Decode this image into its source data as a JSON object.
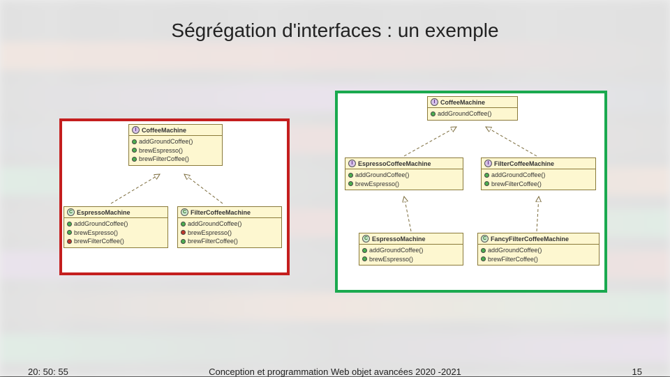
{
  "title": "Ségrégation d'interfaces : un exemple",
  "footer": {
    "time": "20: 50: 55",
    "caption": "Conception et programmation Web objet avancées 2020 -2021",
    "page": "15"
  },
  "icons": {
    "interface": "I",
    "class": "C"
  },
  "left": {
    "top": {
      "name": "CoffeeMachine",
      "methods": [
        {
          "marker": "green",
          "label": "addGroundCoffee()"
        },
        {
          "marker": "green",
          "label": "brewEspresso()"
        },
        {
          "marker": "green",
          "label": "brewFilterCoffee()"
        }
      ]
    },
    "bl": {
      "name": "EspressoMachine",
      "methods": [
        {
          "marker": "green",
          "label": "addGroundCoffee()"
        },
        {
          "marker": "green",
          "label": "brewEspresso()"
        },
        {
          "marker": "red",
          "label": "brewFilterCoffee()"
        }
      ]
    },
    "br": {
      "name": "FilterCoffeeMachine",
      "methods": [
        {
          "marker": "green",
          "label": "addGroundCoffee()"
        },
        {
          "marker": "red",
          "label": "brewEspresso()"
        },
        {
          "marker": "green",
          "label": "brewFilterCoffee()"
        }
      ]
    }
  },
  "right": {
    "top": {
      "name": "CoffeeMachine",
      "methods": [
        {
          "marker": "green",
          "label": "addGroundCoffee()"
        }
      ]
    },
    "ml": {
      "name": "EspressoCoffeeMachine",
      "methods": [
        {
          "marker": "green",
          "label": "addGroundCoffee()"
        },
        {
          "marker": "green",
          "label": "brewEspresso()"
        }
      ]
    },
    "mr": {
      "name": "FilterCoffeeMachine",
      "methods": [
        {
          "marker": "green",
          "label": "addGroundCoffee()"
        },
        {
          "marker": "green",
          "label": "brewFilterCoffee()"
        }
      ]
    },
    "bl": {
      "name": "EspressoMachine",
      "methods": [
        {
          "marker": "green",
          "label": "addGroundCoffee()"
        },
        {
          "marker": "green",
          "label": "brewEspresso()"
        }
      ]
    },
    "br": {
      "name": "FancyFilterCoffeeMachine",
      "methods": [
        {
          "marker": "green",
          "label": "addGroundCoffee()"
        },
        {
          "marker": "green",
          "label": "brewFilterCoffee()"
        }
      ]
    }
  }
}
